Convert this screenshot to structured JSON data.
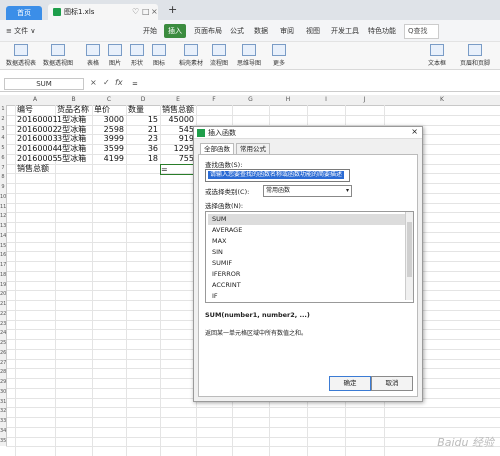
{
  "titlebar": {
    "home_tab": "首页",
    "file_tab": "图标1.xls",
    "new_tab": "+"
  },
  "menu": {
    "file": "≡ 文件 ∨",
    "items": [
      "开始",
      "插入",
      "页面布局",
      "公式",
      "数据",
      "审阅",
      "视图",
      "开发工具",
      "特色功能"
    ],
    "active": "插入",
    "search": "Q查找"
  },
  "toolbar": {
    "items": [
      "数据透视表",
      "数据透视图",
      "表格",
      "图片",
      "形状",
      "图标",
      "稻壳素材",
      "流程图",
      "思维导图",
      "更多",
      "文本框",
      "页眉和页脚"
    ]
  },
  "formula_bar": {
    "name_box": "SUM",
    "cancel": "×",
    "confirm": "✓",
    "fx": "fx",
    "formula": "="
  },
  "grid": {
    "columns": [
      "A",
      "B",
      "C",
      "D",
      "E",
      "F",
      "G",
      "H",
      "I",
      "J",
      "K"
    ],
    "rows": [
      "1",
      "2",
      "3",
      "4",
      "5",
      "6",
      "7",
      "8",
      "9",
      "10",
      "11",
      "12",
      "13",
      "14",
      "15",
      "16",
      "17",
      "18",
      "19",
      "20",
      "21",
      "22",
      "23",
      "24",
      "25",
      "26",
      "27",
      "28",
      "29",
      "30",
      "31",
      "32",
      "33",
      "34",
      "35"
    ],
    "header": [
      "编号",
      "货品名称",
      "单价",
      "数量",
      "销售总额"
    ],
    "data": [
      [
        "20160001",
        "1型冰箱",
        "3000",
        "15",
        "45000"
      ],
      [
        "20160002",
        "2型冰箱",
        "2598",
        "21",
        "545"
      ],
      [
        "20160003",
        "3型冰箱",
        "3999",
        "23",
        "919"
      ],
      [
        "20160004",
        "4型冰箱",
        "3599",
        "36",
        "1295"
      ],
      [
        "20160005",
        "5型冰箱",
        "4199",
        "18",
        "755"
      ]
    ],
    "total_label": "销售总额",
    "active_cell_value": "="
  },
  "dialog": {
    "title": "插入函数",
    "close": "×",
    "tabs": [
      "全部函数",
      "常用公式"
    ],
    "search_label": "查找函数(S):",
    "search_placeholder": "请输入您要查找的函数名称或函数功能的简要描述",
    "category_label": "或选择类别(C):",
    "category_value": "常用函数",
    "list_label": "选择函数(N):",
    "functions": [
      "SUM",
      "AVERAGE",
      "MAX",
      "SIN",
      "SUMIF",
      "IFERROR",
      "ACCRINT",
      "IF"
    ],
    "selected": "SUM",
    "signature": "SUM(number1, number2, ...)",
    "description": "返回某一单元格区域中所有数值之和。",
    "ok": "确定",
    "cancel": "取消"
  },
  "watermark": "Baidu 经验"
}
